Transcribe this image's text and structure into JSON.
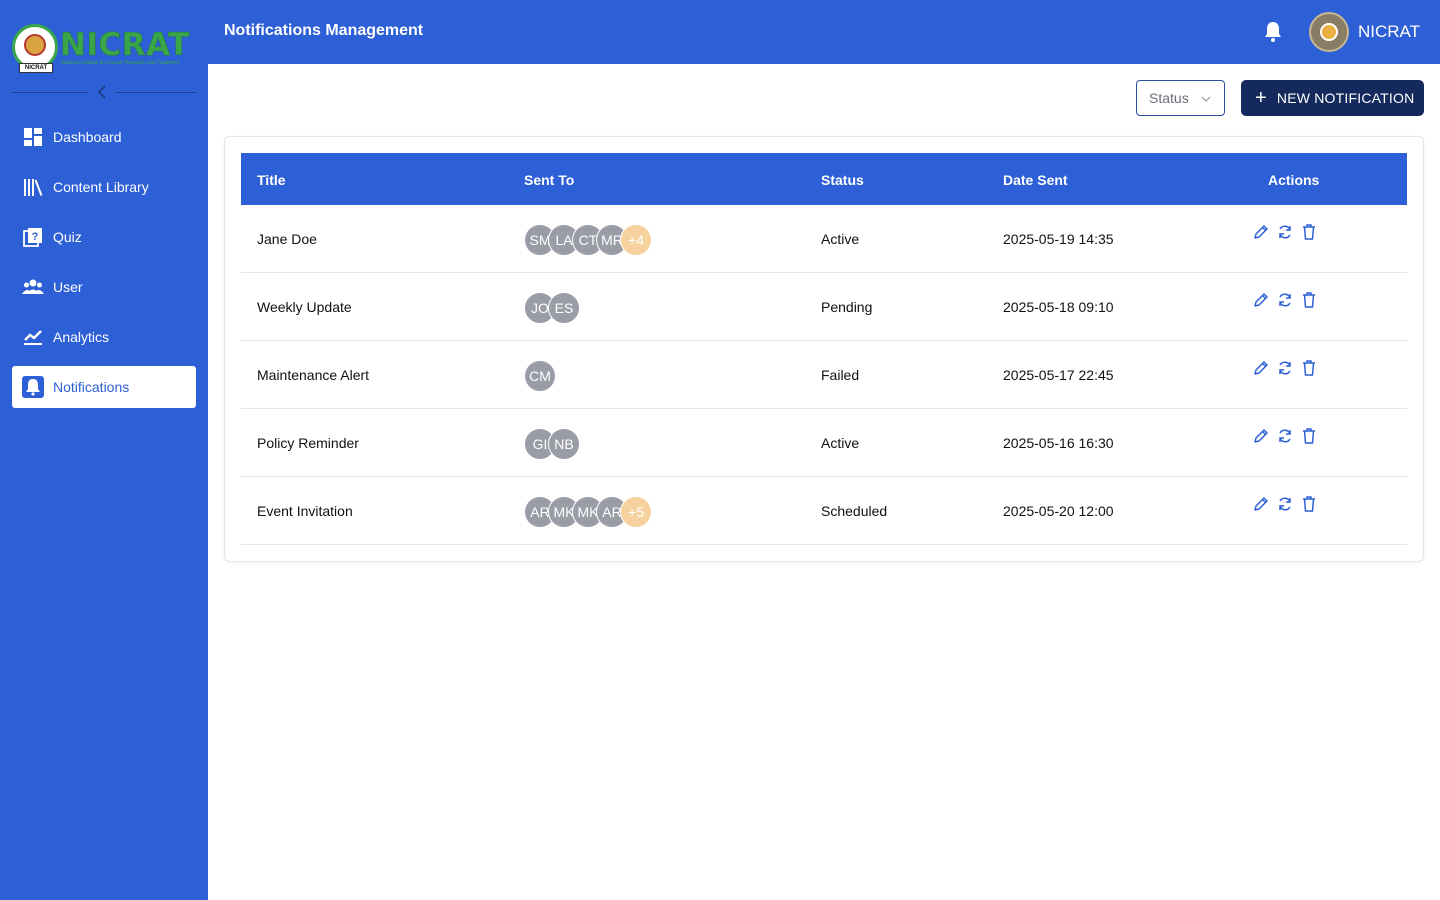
{
  "brand": {
    "logo_text": "NICRAT",
    "logo_subtitle": "National Institute for Cancer Research and Treatment",
    "logo_tag": "NICRAT",
    "primary_color": "#2d5fd6",
    "dark_button_color": "#142a5c",
    "logo_color": "#3aa64a"
  },
  "sidebar": {
    "collapse_icon": "chevron-left-icon",
    "items": [
      {
        "label": "Dashboard",
        "icon": "dashboard-icon",
        "active": false
      },
      {
        "label": "Content Library",
        "icon": "library-icon",
        "active": false
      },
      {
        "label": "Quiz",
        "icon": "quiz-icon",
        "active": false
      },
      {
        "label": "User",
        "icon": "users-icon",
        "active": false
      },
      {
        "label": "Analytics",
        "icon": "analytics-icon",
        "active": false
      },
      {
        "label": "Notifications",
        "icon": "bell-icon",
        "active": true
      }
    ]
  },
  "header": {
    "title": "Notifications Management",
    "bell_icon": "bell-icon",
    "user_name": "NICRAT"
  },
  "toolbar": {
    "status_filter_label": "Status",
    "new_button_label": "NEW NOTIFICATION",
    "new_button_icon": "plus-icon"
  },
  "table": {
    "columns": [
      "Title",
      "Sent To",
      "Status",
      "Date Sent",
      "Actions"
    ],
    "action_icons": [
      "edit-icon",
      "resend-icon",
      "delete-icon"
    ],
    "rows": [
      {
        "title": "Jane Doe",
        "recipients": [
          "SM",
          "LA",
          "CT",
          "MR"
        ],
        "more": "+4",
        "status": "Active",
        "date": "2025-05-19 14:35"
      },
      {
        "title": "Weekly Update",
        "recipients": [
          "JO",
          "ES"
        ],
        "more": "",
        "status": "Pending",
        "date": "2025-05-18 09:10"
      },
      {
        "title": "Maintenance Alert",
        "recipients": [
          "CM"
        ],
        "more": "",
        "status": "Failed",
        "date": "2025-05-17 22:45"
      },
      {
        "title": "Policy Reminder",
        "recipients": [
          "GI",
          "NB"
        ],
        "more": "",
        "status": "Active",
        "date": "2025-05-16 16:30"
      },
      {
        "title": "Event Invitation",
        "recipients": [
          "AR",
          "MK",
          "MK",
          "AR"
        ],
        "more": "+5",
        "status": "Scheduled",
        "date": "2025-05-20 12:00"
      }
    ]
  }
}
